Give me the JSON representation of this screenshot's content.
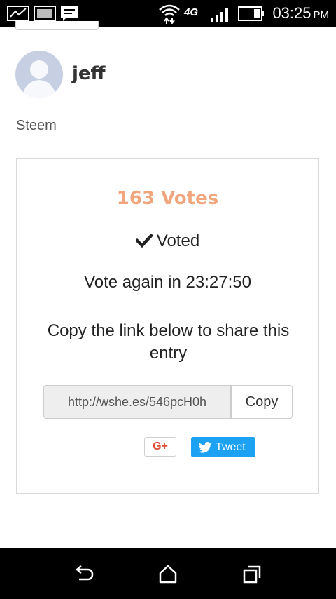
{
  "status_bar": {
    "network": "4G",
    "time": "03:25",
    "ampm": "PM"
  },
  "post": {
    "author": "jeff",
    "category": "Steem"
  },
  "vote_card": {
    "votes_text": "163 Votes",
    "voted_label": "Voted",
    "vote_again": "Vote again in 23:27:50",
    "share_text": "Copy the link below to share this entry",
    "share_link": "http://wshe.es/546pcH0h",
    "copy_label": "Copy",
    "gplus_label": "G+",
    "tweet_label": "Tweet"
  },
  "colors": {
    "votes": "#f0a57c",
    "tweet": "#1da1f2",
    "gplus": "#dd4b39"
  }
}
